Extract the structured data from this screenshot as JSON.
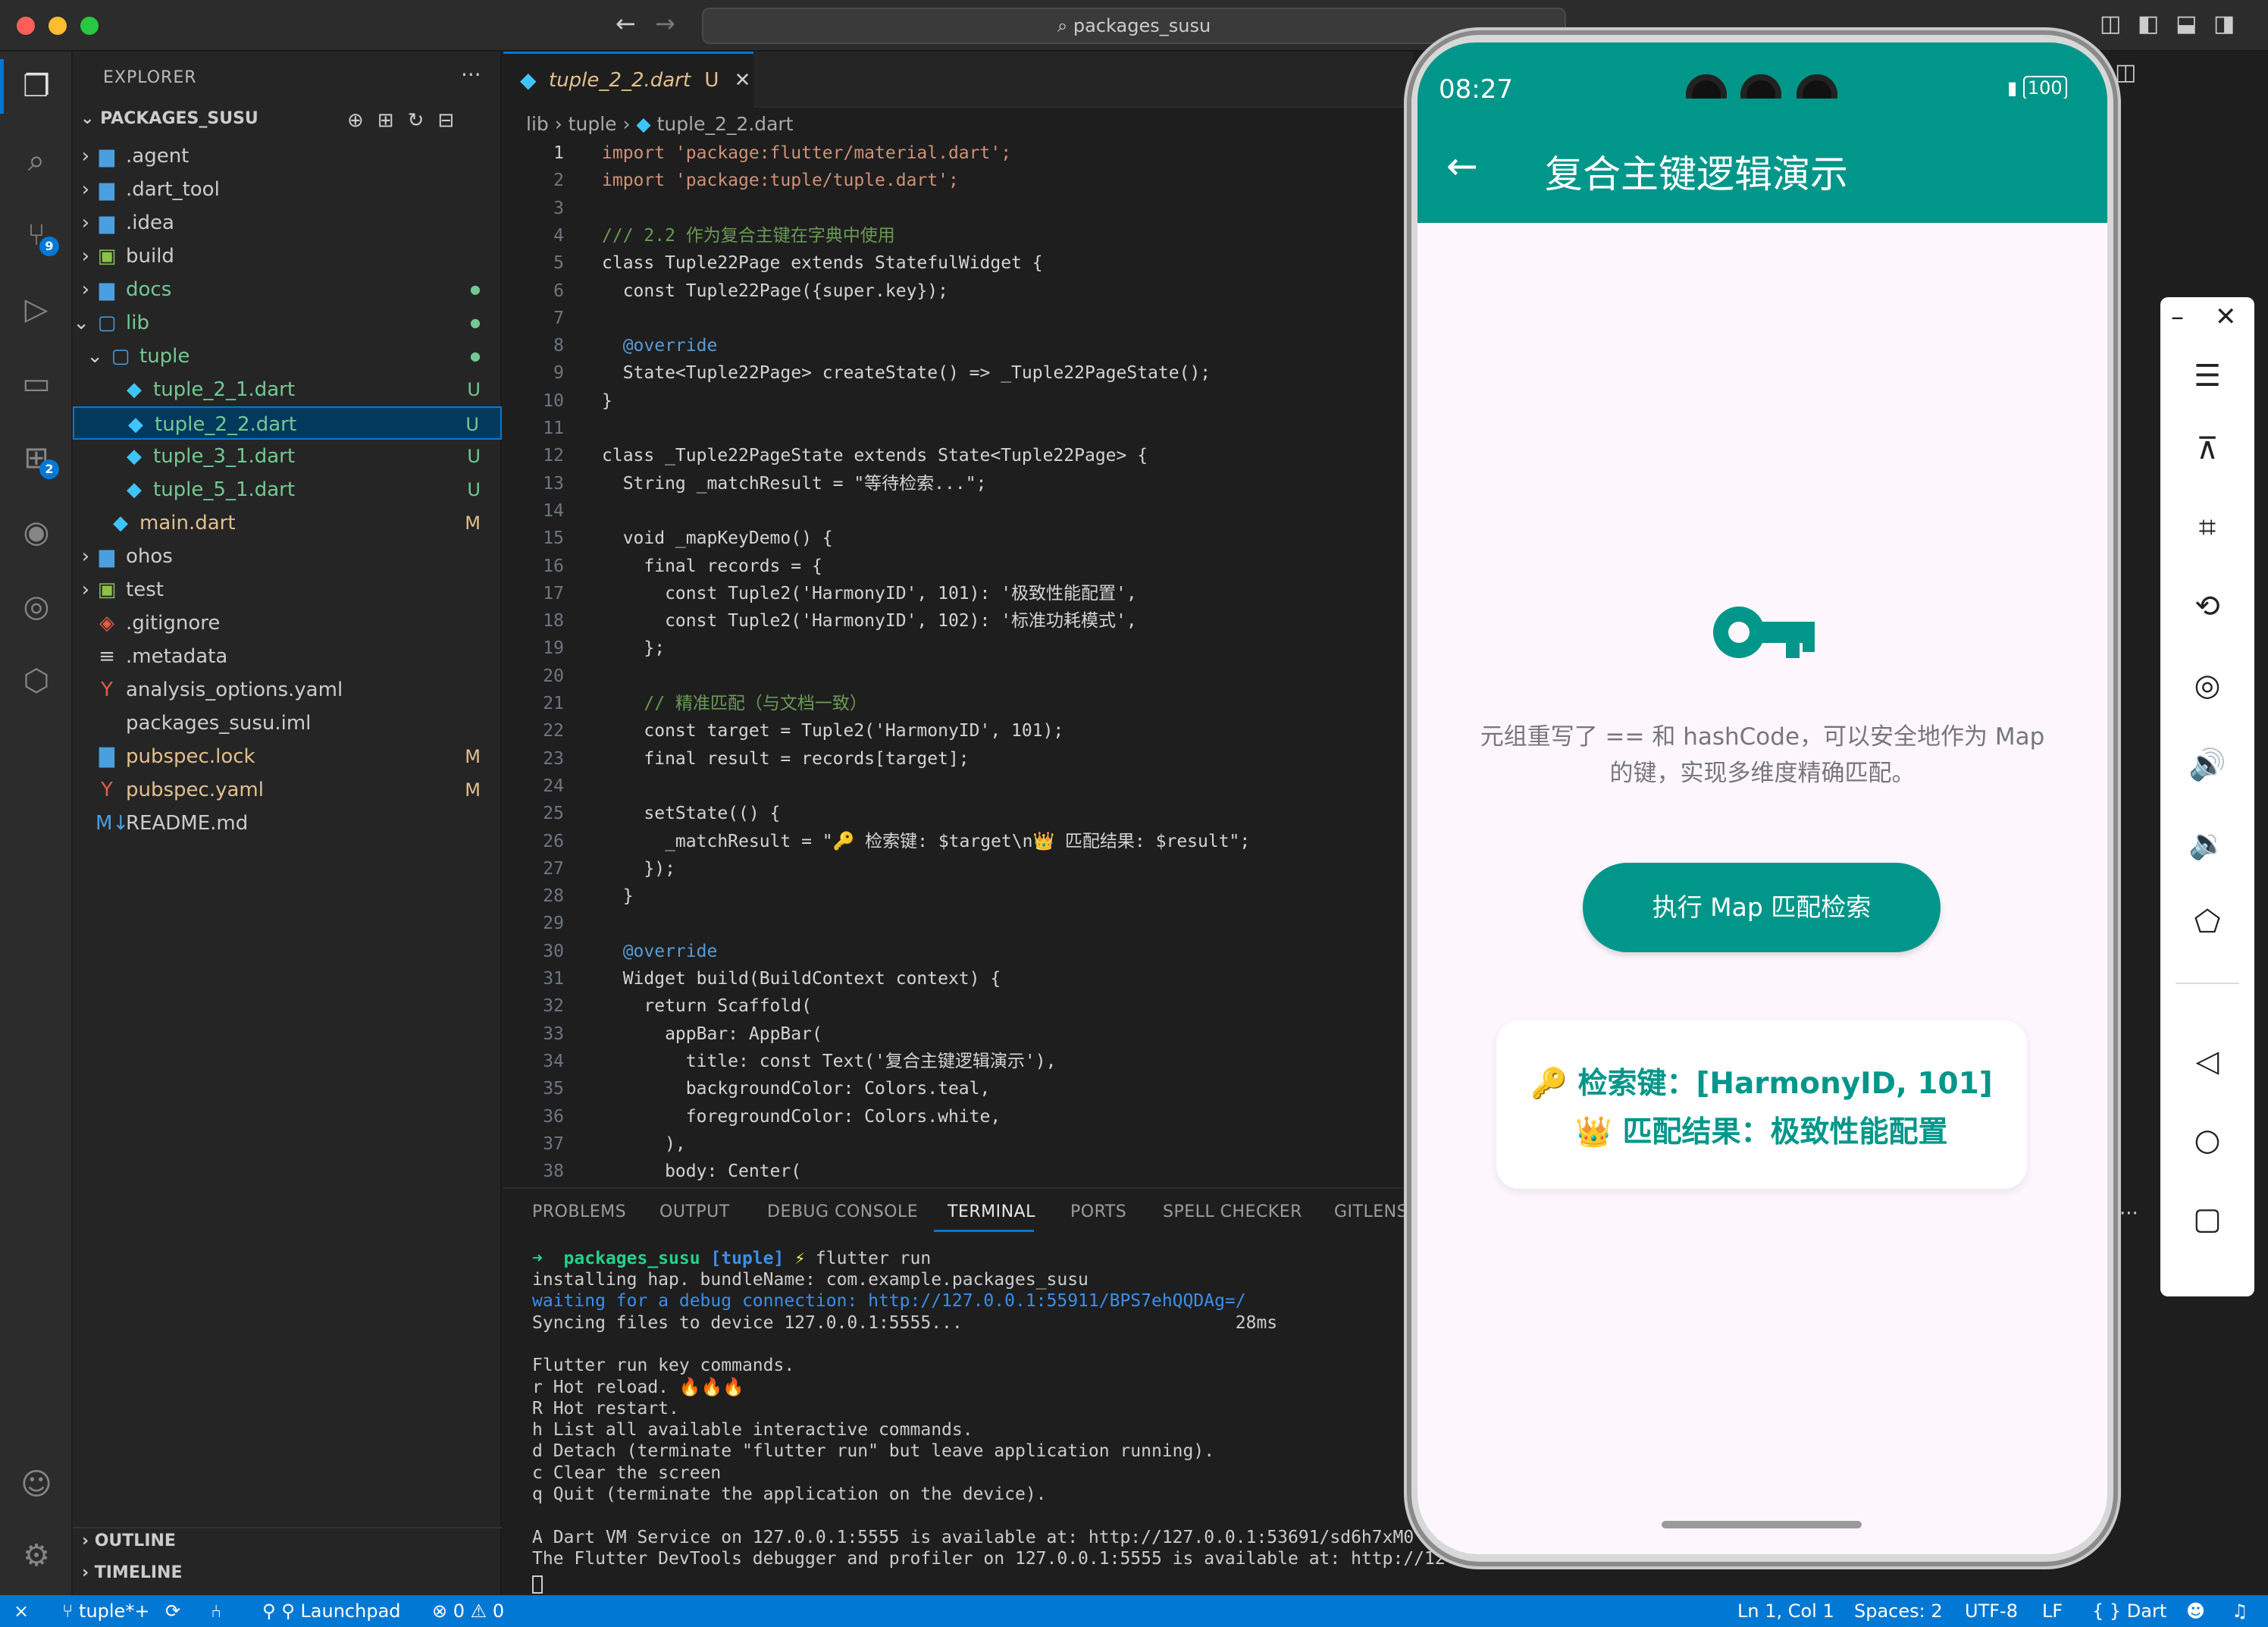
{
  "titlebar": {
    "search": "packages_susu"
  },
  "activity": {
    "scm_badge": "9",
    "ext_badge": "2"
  },
  "explorer": {
    "header": "EXPLORER",
    "root": "PACKAGES_SUSU",
    "items": [
      {
        "label": ".agent",
        "status": ""
      },
      {
        "label": ".dart_tool",
        "status": ""
      },
      {
        "label": ".idea",
        "status": ""
      },
      {
        "label": "build",
        "status": ""
      },
      {
        "label": "docs",
        "status": ""
      },
      {
        "label": "lib",
        "status": ""
      },
      {
        "label": "tuple",
        "status": ""
      },
      {
        "label": "tuple_2_1.dart",
        "status": "U"
      },
      {
        "label": "tuple_2_2.dart",
        "status": "U"
      },
      {
        "label": "tuple_3_1.dart",
        "status": "U"
      },
      {
        "label": "tuple_5_1.dart",
        "status": "U"
      },
      {
        "label": "main.dart",
        "status": "M"
      },
      {
        "label": "ohos",
        "status": ""
      },
      {
        "label": "test",
        "status": ""
      },
      {
        "label": ".gitignore",
        "status": ""
      },
      {
        "label": ".metadata",
        "status": ""
      },
      {
        "label": "analysis_options.yaml",
        "status": ""
      },
      {
        "label": "packages_susu.iml",
        "status": ""
      },
      {
        "label": "pubspec.lock",
        "status": "M"
      },
      {
        "label": "pubspec.yaml",
        "status": "M"
      },
      {
        "label": "README.md",
        "status": ""
      }
    ],
    "outline": "OUTLINE",
    "timeline": "TIMELINE"
  },
  "editor": {
    "tab_label": "tuple_2_2.dart",
    "tab_status": "U",
    "breadcrumb": [
      "lib",
      "tuple",
      "tuple_2_2.dart"
    ],
    "lines": [
      "import 'package:flutter/material.dart';",
      "import 'package:tuple/tuple.dart';",
      "",
      "/// 2.2 作为复合主键在字典中使用",
      "class Tuple22Page extends StatefulWidget {",
      "  const Tuple22Page({super.key});",
      "",
      "  @override",
      "  State<Tuple22Page> createState() => _Tuple22PageState();",
      "}",
      "",
      "class _Tuple22PageState extends State<Tuple22Page> {",
      "  String _matchResult = \"等待检索...\";",
      "",
      "  void _mapKeyDemo() {",
      "    final records = {",
      "      const Tuple2('HarmonyID', 101): '极致性能配置',",
      "      const Tuple2('HarmonyID', 102): '标准功耗模式',",
      "    };",
      "",
      "    // 精准匹配（与文档一致）",
      "    const target = Tuple2('HarmonyID', 101);",
      "    final result = records[target];",
      "",
      "    setState(() {",
      "      _matchResult = \"🔑 检索键: $target\\n👑 匹配结果: $result\";",
      "    });",
      "  }",
      "",
      "  @override",
      "  Widget build(BuildContext context) {",
      "    return Scaffold(",
      "      appBar: AppBar(",
      "        title: const Text('复合主键逻辑演示'),",
      "        backgroundColor: Colors.teal,",
      "        foregroundColor: Colors.white,",
      "      ),",
      "      body: Center("
    ]
  },
  "panel": {
    "tabs": [
      "PROBLEMS",
      "OUTPUT",
      "DEBUG CONSOLE",
      "TERMINAL",
      "PORTS",
      "SPELL CHECKER",
      "GITLENS"
    ],
    "prompt_dir": "packages_susu",
    "prompt_branch": "[tuple]",
    "prompt_cmd": "flutter run",
    "terminal": [
      "installing hap. bundleName: com.example.packages_susu",
      "waiting for a debug connection: http://127.0.0.1:55911/BPS7ehQQDAg=/",
      "Syncing files to device 127.0.0.1:5555...                          28ms",
      "",
      "Flutter run key commands.",
      "r Hot reload. 🔥🔥🔥",
      "R Hot restart.",
      "h List all available interactive commands.",
      "d Detach (terminate \"flutter run\" but leave application running).",
      "c Clear the screen",
      "q Quit (terminate the application on the device).",
      "",
      "A Dart VM Service on 127.0.0.1:5555 is available at: http://127.0.0.1:53691/sd6h7xM0",
      "The Flutter DevTools debugger and profiler on 127.0.0.1:5555 is available at: http://12"
    ]
  },
  "statusbar": {
    "branch": "tuple*+",
    "launchpad": "Launchpad",
    "errors": "0",
    "warnings": "0",
    "position": "Ln 1, Col 1",
    "spaces": "Spaces: 2",
    "encoding": "UTF-8",
    "eol": "LF",
    "language": "Dart"
  },
  "phone": {
    "time": "08:27",
    "battery": "100",
    "app_title": "复合主键逻辑演示",
    "description_1": "元组重写了 == 和 hashCode，可以安全地作为 Map",
    "description_2": "的键，实现多维度精确匹配。",
    "button": "执行 Map 匹配检索",
    "result_1": "🔑 检索键：[HarmonyID, 101]",
    "result_2": "👑 匹配结果：极致性能配置",
    "teal": "#00968a"
  }
}
